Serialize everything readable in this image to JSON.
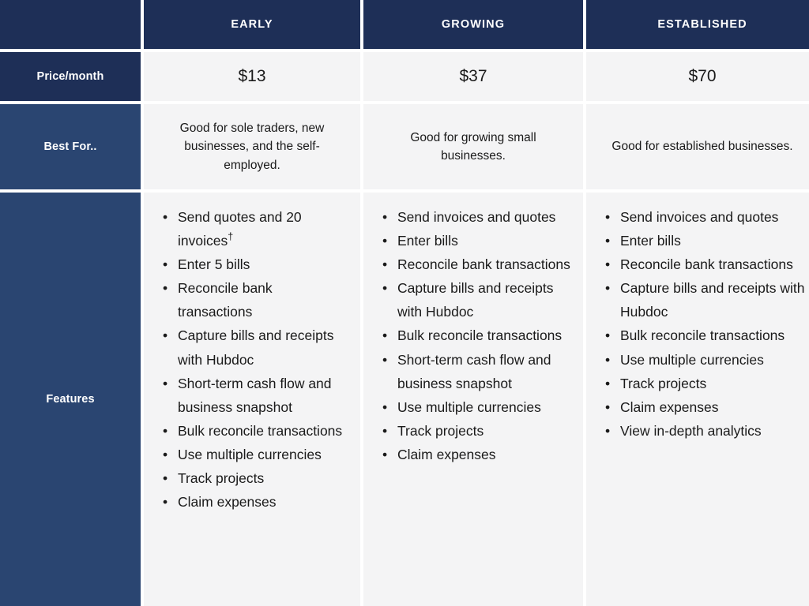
{
  "table": {
    "row_labels": {
      "corner": "",
      "price": "Price/month",
      "best_for": "Best For..",
      "features": "Features"
    },
    "plans": [
      {
        "name": "EARLY",
        "price": "$13",
        "best_for": "Good for sole traders, new businesses, and the self-employed.",
        "features": [
          "Send quotes and 20 invoices",
          "Enter 5 bills",
          "Reconcile bank transactions",
          "Capture bills and receipts with Hubdoc",
          "Short-term cash flow and business snapshot",
          "Bulk reconcile transactions",
          "Use multiple currencies",
          "Track projects",
          "Claim expenses"
        ],
        "feature_footnote_index": 0,
        "feature_footnote_symbol": "†"
      },
      {
        "name": "GROWING",
        "price": "$37",
        "best_for": "Good for growing small businesses.",
        "features": [
          "Send invoices and quotes",
          "Enter bills",
          "Reconcile bank transactions",
          "Capture bills and receipts with Hubdoc",
          "Bulk reconcile transactions",
          "Short-term cash flow and business snapshot",
          "Use multiple currencies",
          "Track projects",
          "Claim expenses"
        ],
        "feature_footnote_index": -1,
        "feature_footnote_symbol": ""
      },
      {
        "name": "ESTABLISHED",
        "price": "$70",
        "best_for": "Good for established businesses.",
        "features": [
          "Send invoices and quotes",
          "Enter bills",
          "Reconcile bank transactions",
          "Capture bills and receipts with Hubdoc",
          "Bulk reconcile transactions",
          "Use multiple currencies",
          "Track projects",
          "Claim expenses",
          "View in-depth analytics"
        ],
        "feature_footnote_index": -1,
        "feature_footnote_symbol": ""
      }
    ]
  },
  "colors": {
    "header_navy": "#1e2f57",
    "label_blue": "#2a4571",
    "cell_background": "#f4f4f5",
    "gap": "#ffffff",
    "text_dark": "#1a1a1a",
    "text_light": "#ffffff"
  }
}
